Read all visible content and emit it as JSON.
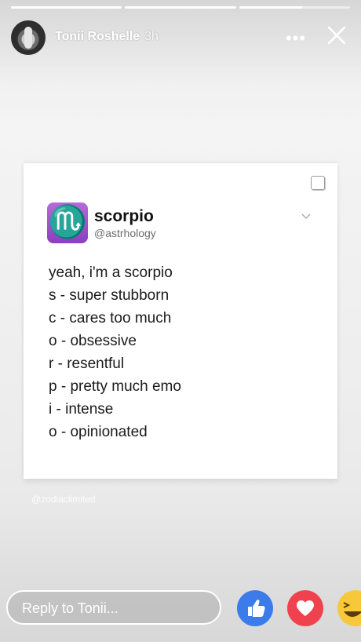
{
  "story": {
    "progress": [
      1,
      1,
      0.57
    ],
    "user": {
      "name": "Tonii Roshelle",
      "time": "3h"
    },
    "menu_label": "•••"
  },
  "post": {
    "logo_symbol": "♏",
    "account_name": "scorpio",
    "handle": "@astrhology",
    "lines": [
      "yeah, i'm a scorpio",
      "s - super stubborn",
      "c - cares too much",
      "o - obsessive",
      "r - resentful",
      "p - pretty much emo",
      "i - intense",
      "o - opinionated"
    ],
    "watermark": "@zodiaclimited"
  },
  "footer": {
    "reply_placeholder": "Reply to Tonii...",
    "reactions": [
      "like-icon",
      "love-icon",
      "haha-icon"
    ]
  },
  "colors": {
    "like": "#3b7bea",
    "love": "#f0424e",
    "haha": "#f7c83a",
    "logo": "#9b4fcf"
  }
}
